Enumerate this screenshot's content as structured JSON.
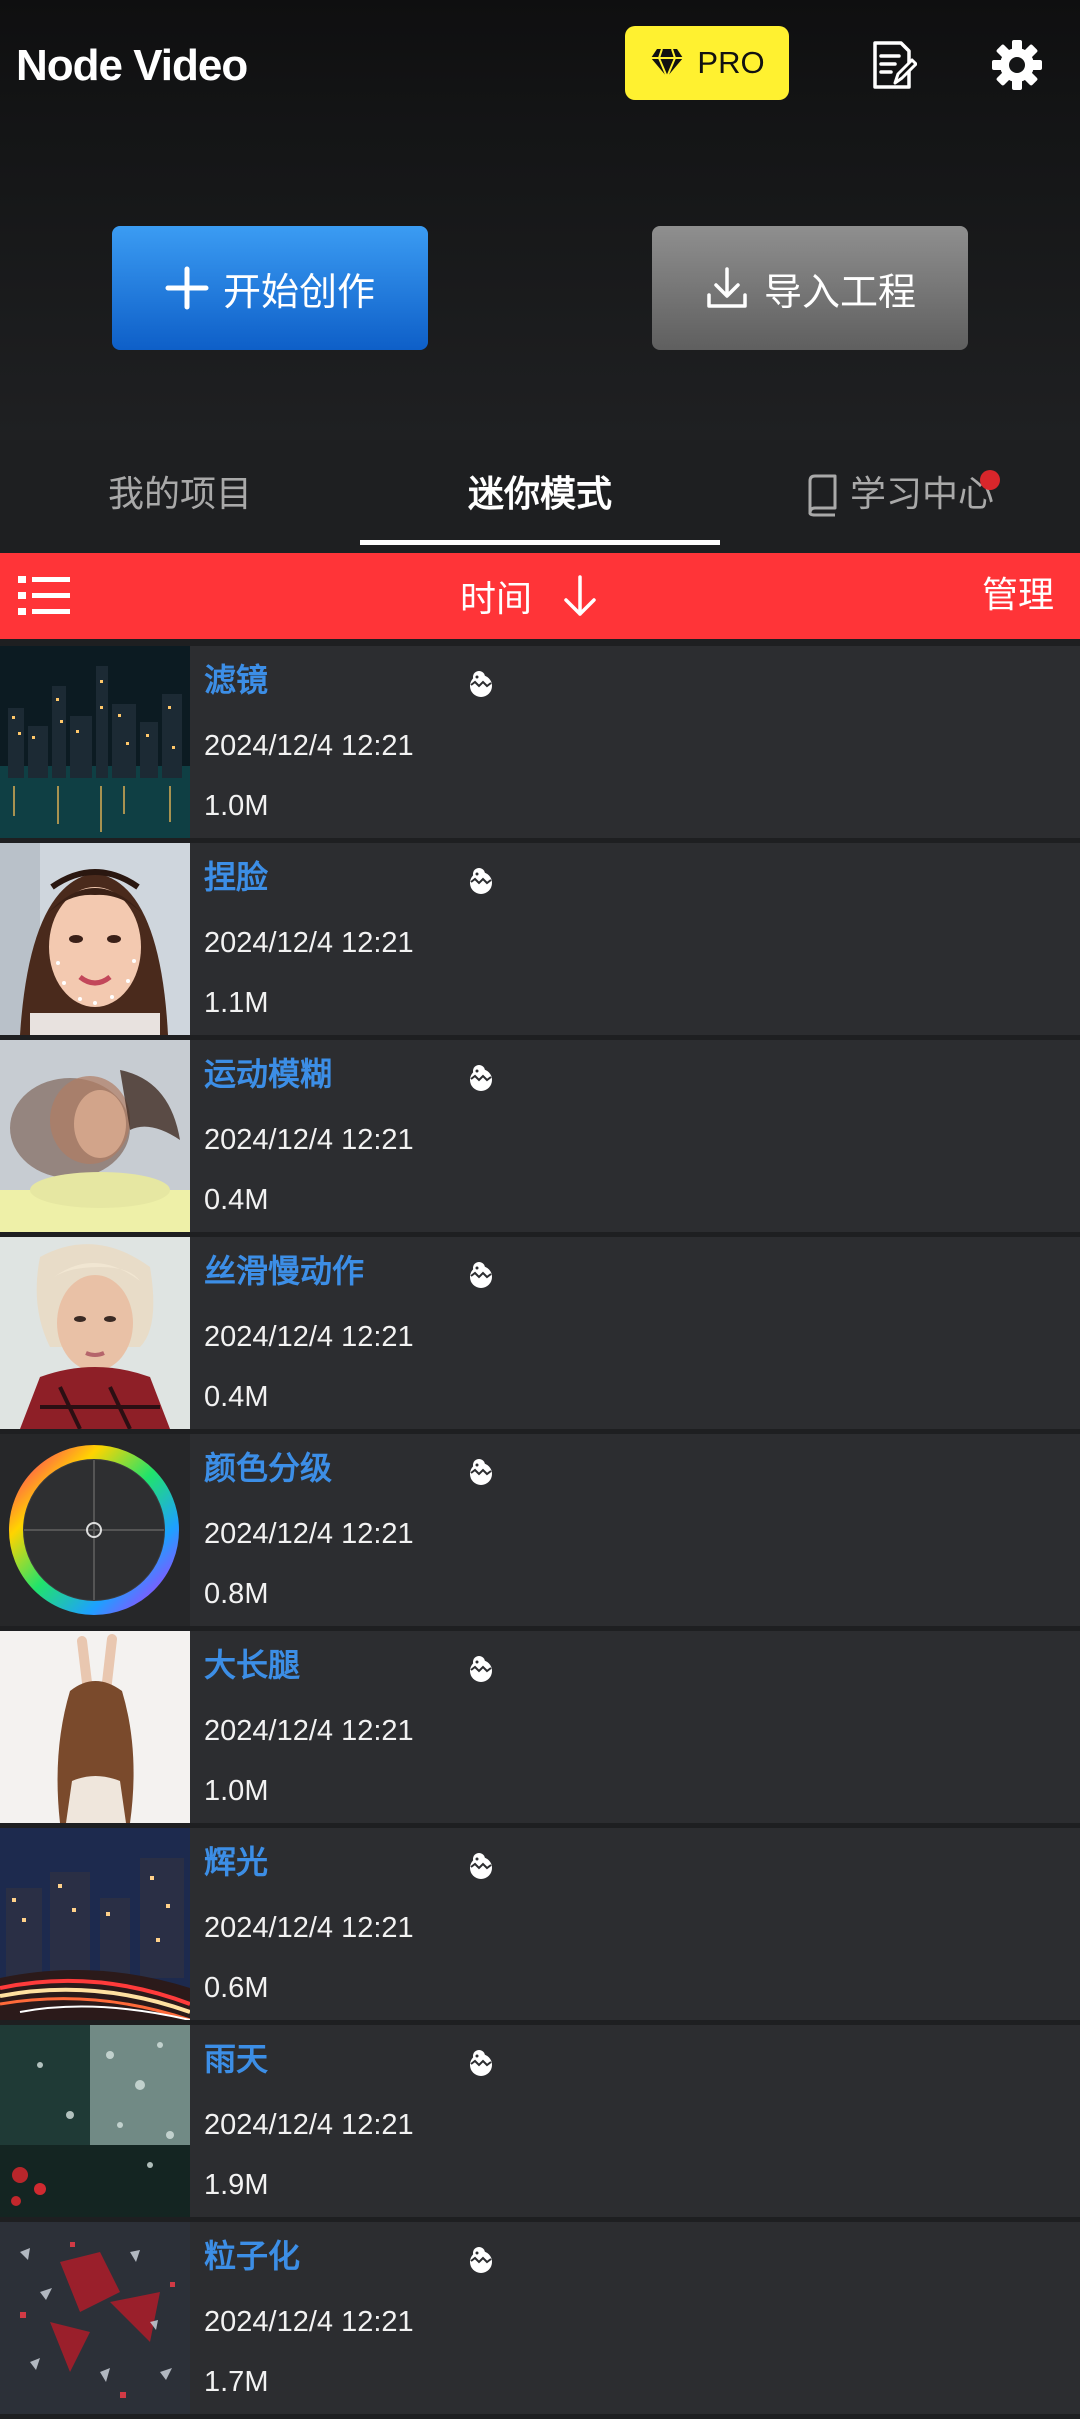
{
  "header": {
    "app_title": "Node Video",
    "pro_label": "PRO",
    "icons": [
      "diamond-icon",
      "notes-icon",
      "gear-icon"
    ]
  },
  "actions": {
    "start_label": "开始创作",
    "import_label": "导入工程"
  },
  "tabs": [
    {
      "label": "我的项目",
      "active": false
    },
    {
      "label": "迷你模式",
      "active": true
    },
    {
      "label": "学习中心",
      "active": false,
      "badge": true
    }
  ],
  "sortbar": {
    "sort_label": "时间",
    "manage_label": "管理",
    "sort_direction": "descending"
  },
  "items": [
    {
      "title": "滤镜",
      "date": "2024/12/4 12:21",
      "size": "1.0M",
      "thumb": "city-night"
    },
    {
      "title": "捏脸",
      "date": "2024/12/4 12:21",
      "size": "1.1M",
      "thumb": "face"
    },
    {
      "title": "运动模糊",
      "date": "2024/12/4 12:21",
      "size": "0.4M",
      "thumb": "motion-blur"
    },
    {
      "title": "丝滑慢动作",
      "date": "2024/12/4 12:21",
      "size": "0.4M",
      "thumb": "portrait"
    },
    {
      "title": "颜色分级",
      "date": "2024/12/4 12:21",
      "size": "0.8M",
      "thumb": "color-wheel"
    },
    {
      "title": "大长腿",
      "date": "2024/12/4 12:21",
      "size": "1.0M",
      "thumb": "stretch"
    },
    {
      "title": "辉光",
      "date": "2024/12/4 12:21",
      "size": "0.6M",
      "thumb": "light-trails"
    },
    {
      "title": "雨天",
      "date": "2024/12/4 12:21",
      "size": "1.9M",
      "thumb": "rain-glass"
    },
    {
      "title": "粒子化",
      "date": "2024/12/4 12:21",
      "size": "1.7M",
      "thumb": "particles"
    }
  ],
  "colors": {
    "accent_blue": "#3c8ee6",
    "sort_bar_red": "#ff3438",
    "pro_yellow": "#fff130",
    "background": "#1e1f21",
    "row": "#2c2d30"
  }
}
